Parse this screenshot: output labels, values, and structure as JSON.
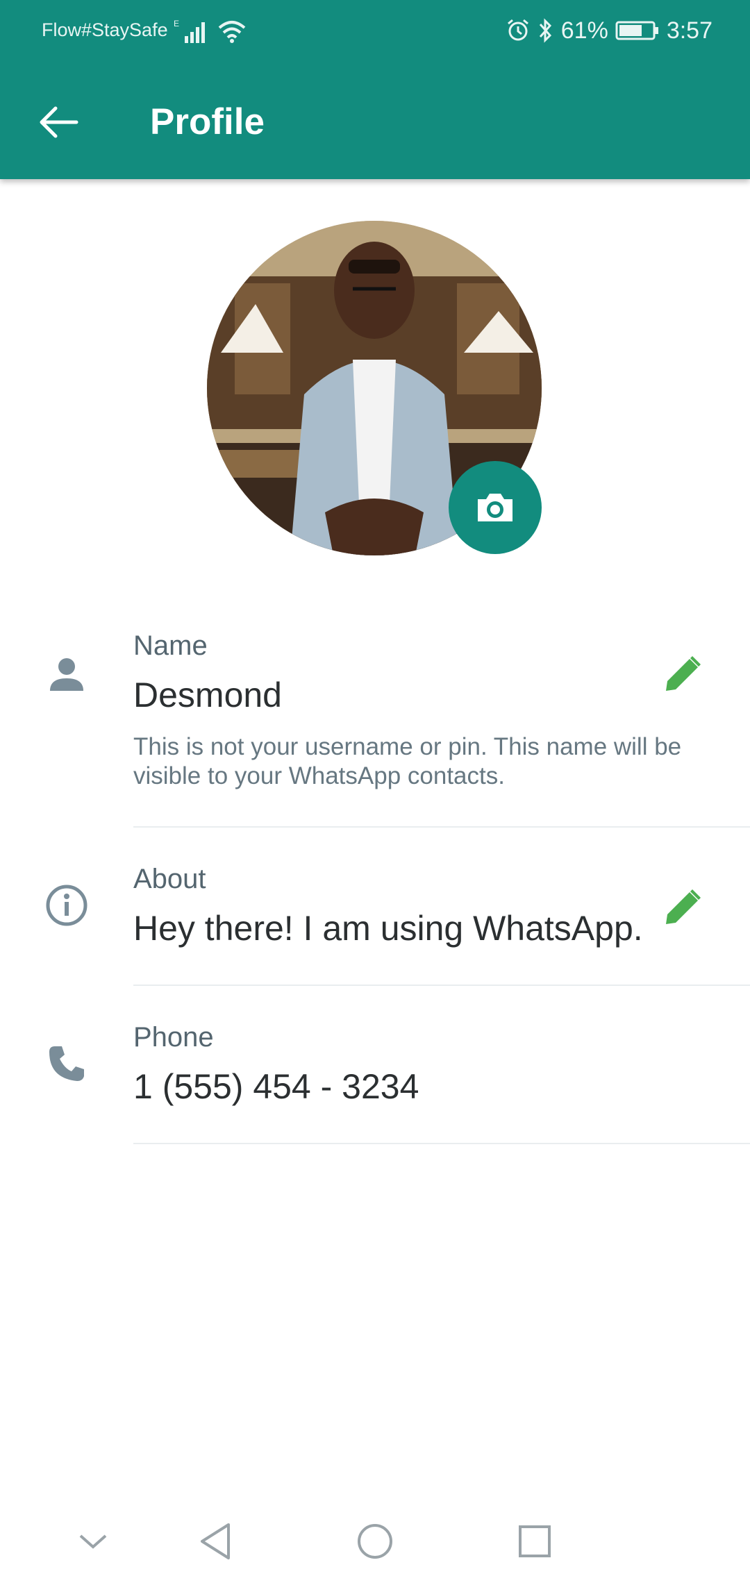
{
  "status_bar": {
    "carrier": "Flow#StaySafe",
    "network_type": "E",
    "battery": "61%",
    "time": "3:57"
  },
  "header": {
    "title": "Profile"
  },
  "profile": {
    "name": {
      "label": "Name",
      "value": "Desmond",
      "hint": "This is not your username or pin. This name will be visible to your WhatsApp contacts."
    },
    "about": {
      "label": "About",
      "value": "Hey there! I am using WhatsApp."
    },
    "phone": {
      "label": "Phone",
      "value": "1 (555) 454 - 3234"
    }
  },
  "icons": {
    "back": "back-arrow-icon",
    "camera": "camera-icon",
    "person": "person-icon",
    "info": "info-icon",
    "phone": "phone-icon",
    "edit": "pencil-icon"
  },
  "colors": {
    "primary": "#128C7E",
    "edit_accent": "#4CAF50",
    "label": "#54656f",
    "text": "#2b2f31"
  }
}
